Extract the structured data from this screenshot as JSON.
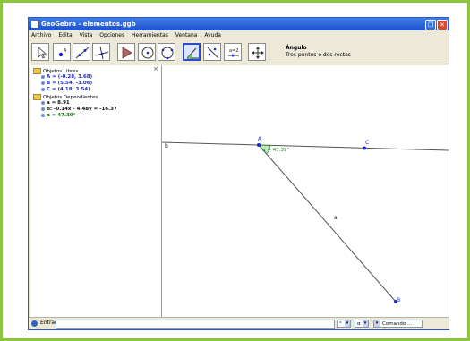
{
  "window": {
    "title": "GeoGebra - elementos.ggb"
  },
  "menu": [
    "Archivo",
    "Edita",
    "Vista",
    "Opciones",
    "Herramientas",
    "Ventana",
    "Ayuda"
  ],
  "toolbar": {
    "active_tool_title": "Ángulo",
    "active_tool_description": "Tres puntos o dos rectas",
    "tools": [
      "move-tool",
      "point-tool",
      "line-tool",
      "perpendicular-tool",
      "polygon-tool",
      "circle-tool",
      "conic-tool",
      "angle-tool",
      "reflect-tool",
      "slider-tool",
      "move-view-tool"
    ]
  },
  "algebra": {
    "close_label": "×",
    "free_folder": "Objetos Libres",
    "free_items": [
      "A = (-0.28, 3.68)",
      "B = (5.54, -3.06)",
      "C = (4.18, 3.54)"
    ],
    "dependent_folder": "Objetos Dependientes",
    "dependent_items": [
      "a = 8.91",
      "b: -0.14x - 4.48y = -16.37",
      "α = 47.39°"
    ]
  },
  "graphics": {
    "label_A": "A",
    "label_B": "B",
    "label_C": "C",
    "label_a": "a",
    "label_b": "b",
    "angle_label": "α = 47.39°"
  },
  "inputbar": {
    "label": "Entrada:",
    "value": "",
    "combo1": "°",
    "combo2": "α",
    "combo3": "Comando ..."
  }
}
